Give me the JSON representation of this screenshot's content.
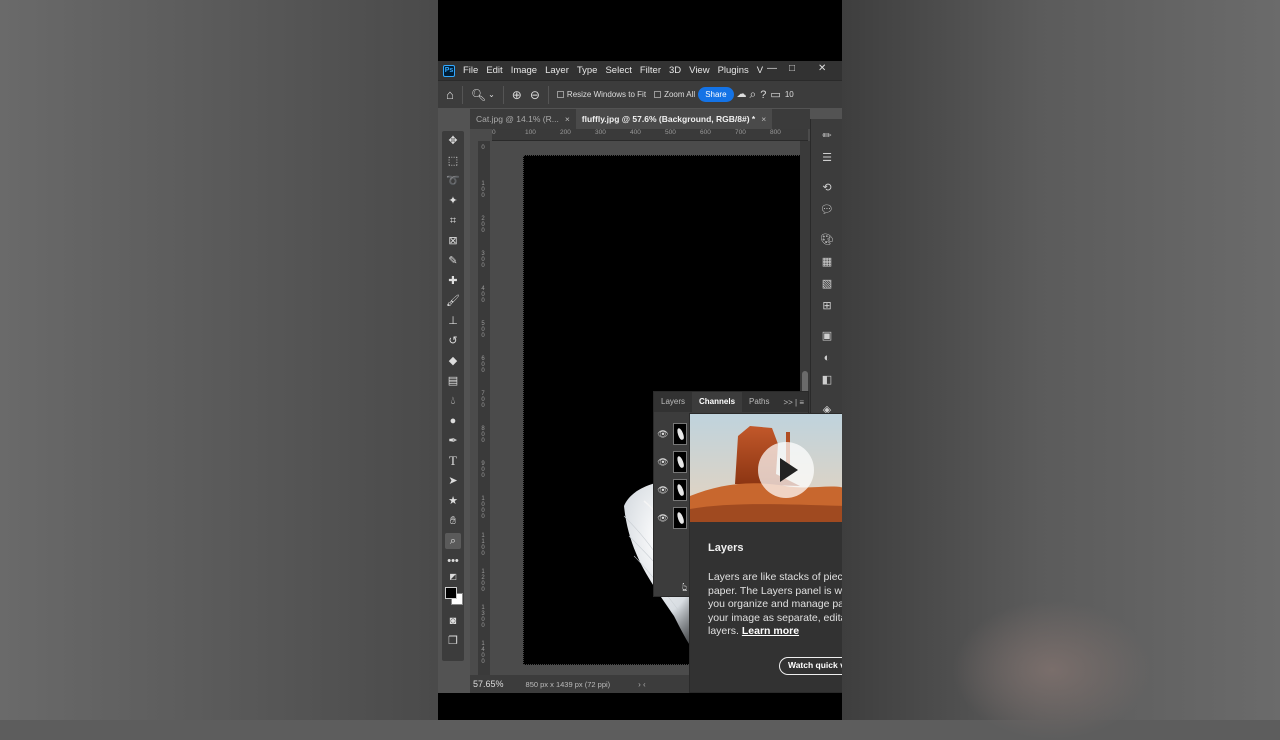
{
  "app": {
    "logo_text": "Ps",
    "menu": [
      "File",
      "Edit",
      "Image",
      "Layer",
      "Type",
      "Select",
      "Filter",
      "3D",
      "View",
      "Plugins",
      "V"
    ],
    "window_controls": [
      "—",
      "□",
      "✕"
    ]
  },
  "options_bar": {
    "resize_windows_label": "Resize Windows to Fit",
    "zoom_all_label": "Zoom All",
    "share_label": "Share",
    "trailing_value": "10"
  },
  "tabs": [
    {
      "label": "Cat.jpg @ 14.1% (R...",
      "close": "×",
      "active": false
    },
    {
      "label": "fluffly.jpg @ 57.6% (Background, RGB/8#) *",
      "close": "×",
      "active": true
    }
  ],
  "ruler": {
    "h_ticks": [
      "0",
      "100",
      "200",
      "300",
      "400",
      "500",
      "600",
      "700",
      "800"
    ],
    "v_ticks": [
      "0",
      "1\n0\n0",
      "2\n0\n0",
      "3\n0\n0",
      "4\n0\n0",
      "5\n0\n0",
      "6\n0\n0",
      "7\n0\n0",
      "8\n0\n0",
      "9\n0\n0",
      "1\n0\n0\n0",
      "1\n1\n0\n0",
      "1\n2\n0\n0",
      "1\n3\n0\n0",
      "1\n4\n0\n0"
    ]
  },
  "status": {
    "zoom": "57.65%",
    "doc_info": "850 px x 1439 px (72 ppi)",
    "arrows": "›  ‹"
  },
  "layers_panel": {
    "tabs": [
      "Layers",
      "Channels",
      "Paths"
    ],
    "active_tab": "Channels",
    "more": ">> | ≡",
    "channel_count": 4
  },
  "popup": {
    "title": "Layers",
    "body": "Layers are like stacks of pieces of paper. The Layers panel is where you organize and manage parts of your image as separate, editable layers.",
    "link": "Learn more",
    "button": "Watch quick vi"
  },
  "colors": {
    "accent": "#1473e6",
    "panel": "#3c3c3c",
    "workspace": "#535353"
  }
}
